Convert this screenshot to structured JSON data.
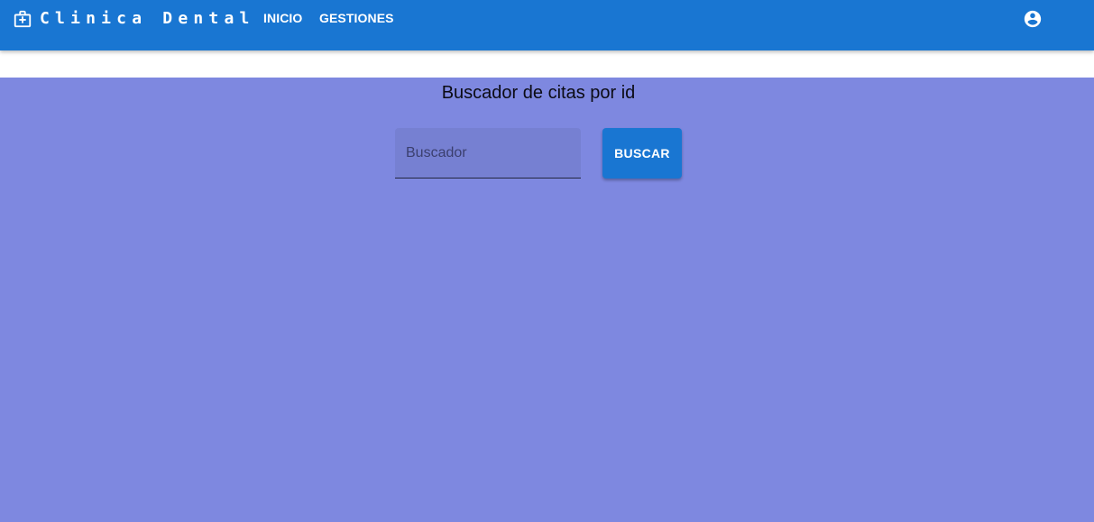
{
  "header": {
    "brand_icon": "medical-bag-icon",
    "title": "Clinica Dental",
    "nav": [
      {
        "label": "INICIO"
      },
      {
        "label": "GESTIONES"
      }
    ],
    "account_icon": "account-circle-icon",
    "bar_color": "#1976d2"
  },
  "main": {
    "background_color": "#7e88e0",
    "title": "Buscador de citas por id",
    "search": {
      "placeholder": "Buscador",
      "value": ""
    },
    "search_button_label": "BUSCAR"
  }
}
